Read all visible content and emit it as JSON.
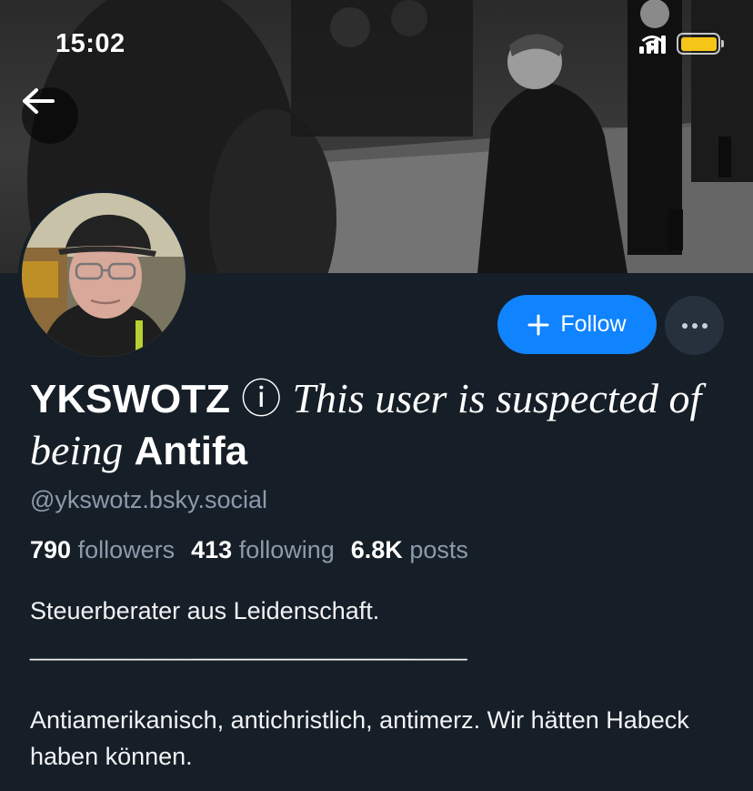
{
  "status_bar": {
    "time": "15:02",
    "battery_color": "#f5c518"
  },
  "banner": {
    "description_icon": "photo-banner"
  },
  "profile": {
    "name": "YKSWOTZ",
    "info_symbol": "ⓘ",
    "name_suffix_italic": "This user is suspected of being",
    "name_suffix_bold": "Antifa",
    "handle": "@ykswotz.bsky.social",
    "stats": [
      {
        "value": "790",
        "label": "followers"
      },
      {
        "value": "413",
        "label": "following"
      },
      {
        "value": "6.8K",
        "label": "posts"
      }
    ],
    "bio": "Steuerberater aus Leidenschaft.\n________________________________\n\nAntiamerikanisch, antichristlich, antimerz. Wir hätten Habeck haben können."
  },
  "actions": {
    "follow_label": "Follow",
    "accent_color": "#1083fe"
  }
}
